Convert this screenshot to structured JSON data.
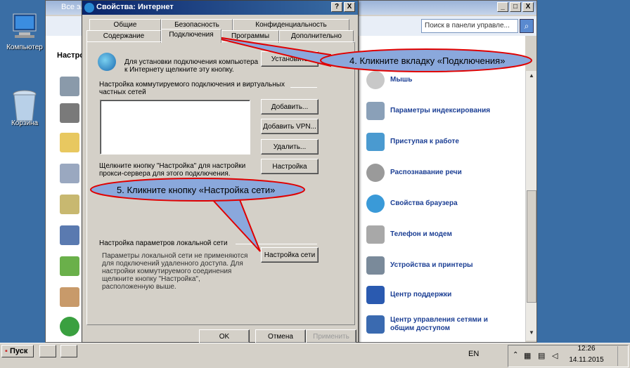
{
  "desktop": {
    "computer": "Компьютер",
    "recycle": "Корзина"
  },
  "bgwindow": {
    "title": "Все эл",
    "left_label": "Настро",
    "search_placeholder": "Поиск в панели управле...",
    "items": [
      "Мышь",
      "Параметры индексирования",
      "Приступая к работе",
      "Распознавание речи",
      "Свойства браузера",
      "Телефон и модем",
      "Устройства и принтеры",
      "Центр поддержки",
      "Центр управления сетями и",
      "общим доступом"
    ]
  },
  "dialog": {
    "title": "Свойства: Интернет",
    "help_btn": "?",
    "close_btn": "X",
    "tabs_top": [
      "Общие",
      "Безопасность",
      "Конфиденциальность"
    ],
    "tabs_bottom": [
      "Содержание",
      "Подключения",
      "Программы",
      "Дополнительно"
    ],
    "setup_text_1": "Для установки подключения компьютера",
    "setup_text_2": "к Интернету щелкните эту кнопку.",
    "install_btn": "Установить",
    "dialup_1": "Настройка коммутируемого подключения и виртуальных",
    "dialup_2": "частных сетей",
    "add_btn": "Добавить...",
    "add_vpn_btn": "Добавить VPN...",
    "delete_btn": "Удалить...",
    "settings_btn": "Настройка",
    "proxy_1": "Щелкните кнопку \"Настройка\" для настройки",
    "proxy_2": "прокси-сервера для этого подключения.",
    "lan_group": "Настройка параметров локальной сети",
    "lan_1": "Параметры локальной сети не применяются",
    "lan_2": "для подключений удаленного доступа. Для",
    "lan_3": "настройки коммутируемого соединения",
    "lan_4": "щелкните кнопку \"Настройка\",",
    "lan_5": "расположенную выше.",
    "lan_btn": "Настройка сети",
    "ok_btn": "OK",
    "cancel_btn": "Отмена",
    "apply_btn": "Применить"
  },
  "callouts": {
    "step4": "4. Кликните вкладку «Подключения»",
    "step5": "5. Кликните кнопку «Настройка сети»"
  },
  "taskbar": {
    "start": "Пуск",
    "lang": "EN",
    "time": "12:26",
    "date": "14.11.2015"
  },
  "colors": {
    "callout_fill": "#8aa8dc",
    "callout_border": "#e00000",
    "link": "#1c3f94"
  }
}
